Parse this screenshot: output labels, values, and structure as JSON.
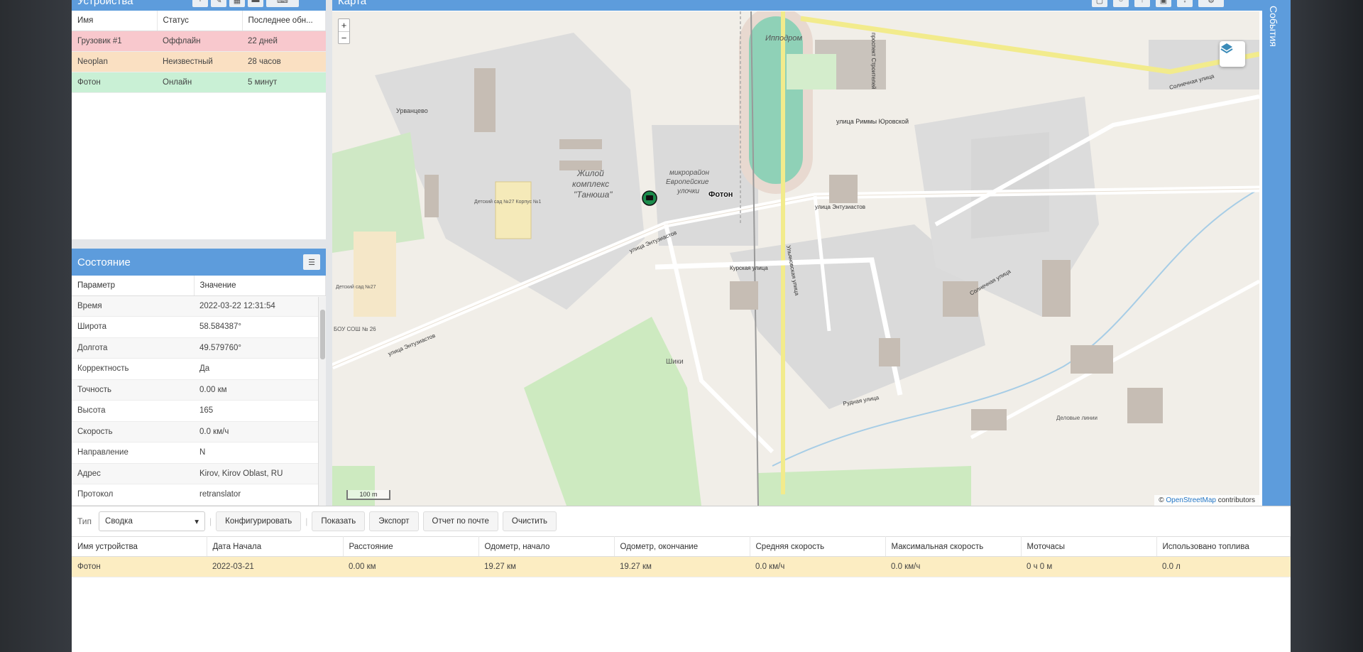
{
  "devices": {
    "title": "Устройства",
    "columns": [
      "Имя",
      "Статус",
      "Последнее обн..."
    ],
    "rows": [
      {
        "name": "Грузовик #1",
        "status": "Оффлайн",
        "last": "22 дней",
        "color": "#f8c8cd"
      },
      {
        "name": "Neoplan",
        "status": "Неизвестный",
        "last": "28 часов",
        "color": "#fae0c2"
      },
      {
        "name": "Фотон",
        "status": "Онлайн",
        "last": "5 минут",
        "color": "#c9f0d5"
      }
    ]
  },
  "state": {
    "title": "Состояние",
    "columns": [
      "Параметр",
      "Значение"
    ],
    "rows": [
      {
        "param": "Время",
        "value": "2022-03-22 12:31:54"
      },
      {
        "param": "Широта",
        "value": "58.584387°"
      },
      {
        "param": "Долгота",
        "value": "49.579760°"
      },
      {
        "param": "Корректность",
        "value": "Да"
      },
      {
        "param": "Точность",
        "value": "0.00 км"
      },
      {
        "param": "Высота",
        "value": "165"
      },
      {
        "param": "Скорость",
        "value": "0.0 км/ч"
      },
      {
        "param": "Направление",
        "value": "N"
      },
      {
        "param": "Адрес",
        "value": "Kirov, Kirov Oblast, RU"
      },
      {
        "param": "Протокол",
        "value": "retranslator"
      }
    ]
  },
  "map": {
    "title": "Карта",
    "zoom_in": "+",
    "zoom_out": "−",
    "vehicle_label": "Фотон",
    "scale": "100 m",
    "attribution_prefix": "© ",
    "attribution_link": "OpenStreetMap",
    "attribution_suffix": " contributors",
    "labels": {
      "hippodrome": "Ипподром",
      "urvantsevo": "Урванцево",
      "complex1": "Жилой",
      "complex2": "комплекс",
      "complex3": "\"Танюша\"",
      "micro1": "микрорайон",
      "micro2": "Европейские",
      "micro3": "улочки",
      "shiki": "Шики",
      "street_rimmy": "улица Риммы Юровской",
      "street_entuz1": "улица Энтузиастов",
      "street_entuz2": "улица Энтузиастов",
      "street_entuz3": "улица Энтузиастов",
      "street_kursk": "Курская улица",
      "street_rudnaya": "Рудная улица",
      "street_solnech": "Солнечная улица",
      "street_ulyan": "Ульяновская улица",
      "street_solnech2": "Солнечная улица",
      "school": "БОУ СОШ № 26",
      "kinder1": "Детский сад №27 Корпус №1",
      "kinder2": "Детский сад №27",
      "delovye": "Деловые линии",
      "prospekt": "проспект Строителей"
    }
  },
  "events": {
    "title": "События"
  },
  "reports": {
    "type_label": "Тип",
    "type_value": "Сводка",
    "buttons": {
      "configure": "Конфигурировать",
      "show": "Показать",
      "export": "Экспорт",
      "email": "Отчет по почте",
      "clear": "Очистить"
    },
    "columns": [
      "Имя устройства",
      "Дата Начала",
      "Расстояние",
      "Одометр, начало",
      "Одометр, окончание",
      "Средняя скорость",
      "Максимальная скорость",
      "Моточасы",
      "Использовано топлива"
    ],
    "rows": [
      {
        "device": "Фотон",
        "start": "2022-03-21",
        "distance": "0.00 км",
        "odo_start": "19.27 км",
        "odo_end": "19.27 км",
        "avg_speed": "0.0 км/ч",
        "max_speed": "0.0 км/ч",
        "hours": "0 ч 0 м",
        "fuel": "0.0 л"
      }
    ]
  }
}
